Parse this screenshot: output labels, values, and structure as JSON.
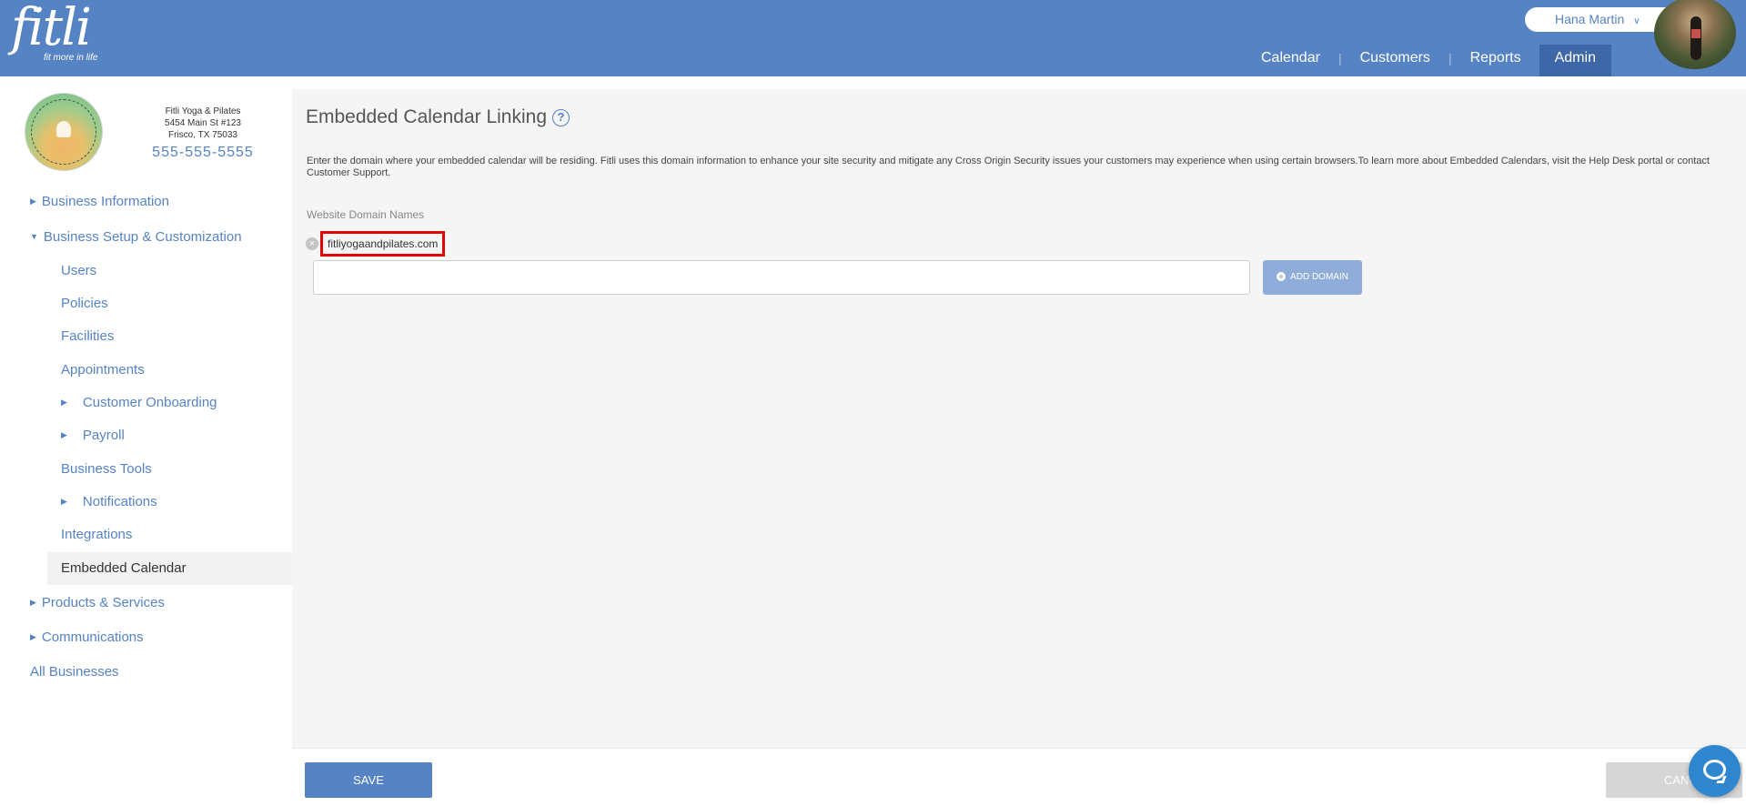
{
  "brand": {
    "logo_text": "fitli",
    "tagline": "fit more in life"
  },
  "user": {
    "name": "Hana Martin"
  },
  "nav": {
    "items": [
      {
        "label": "Calendar",
        "active": false
      },
      {
        "label": "Customers",
        "active": false
      },
      {
        "label": "Reports",
        "active": false
      },
      {
        "label": "Admin",
        "active": true
      }
    ]
  },
  "business": {
    "name": "Fitli Yoga & Pilates",
    "address1": "5454 Main St #123",
    "address2": "Frisco, TX 75033",
    "phone": "555-555-5555"
  },
  "sidebar": {
    "business_information": "Business Information",
    "business_setup": "Business Setup & Customization",
    "users": "Users",
    "policies": "Policies",
    "facilities": "Facilities",
    "appointments": "Appointments",
    "customer_onboarding": "Customer Onboarding",
    "payroll": "Payroll",
    "business_tools": "Business Tools",
    "notifications": "Notifications",
    "integrations": "Integrations",
    "embedded_calendar": "Embedded Calendar",
    "products_services": "Products & Services",
    "communications": "Communications",
    "all_businesses": "All Businesses"
  },
  "main": {
    "title": "Embedded Calendar Linking",
    "description": "Enter the domain where your embedded calendar will be residing. Fitli uses this domain information to enhance your site security and mitigate any Cross Origin Security issues your customers may experience when using certain browsers.To learn more about Embedded Calendars, visit the Help Desk portal or contact Customer Support.",
    "field_label": "Website Domain Names",
    "domains": [
      "fitliyogaandpilates.com"
    ],
    "domain_input_value": "",
    "add_domain_label": "ADD DOMAIN"
  },
  "footer": {
    "save_label": "SAVE",
    "cancel_label": "CANCEL"
  },
  "colors": {
    "primary": "#5583c4",
    "active_nav": "#3d67a6",
    "highlight": "#e30000",
    "chat": "#2f86cf"
  }
}
